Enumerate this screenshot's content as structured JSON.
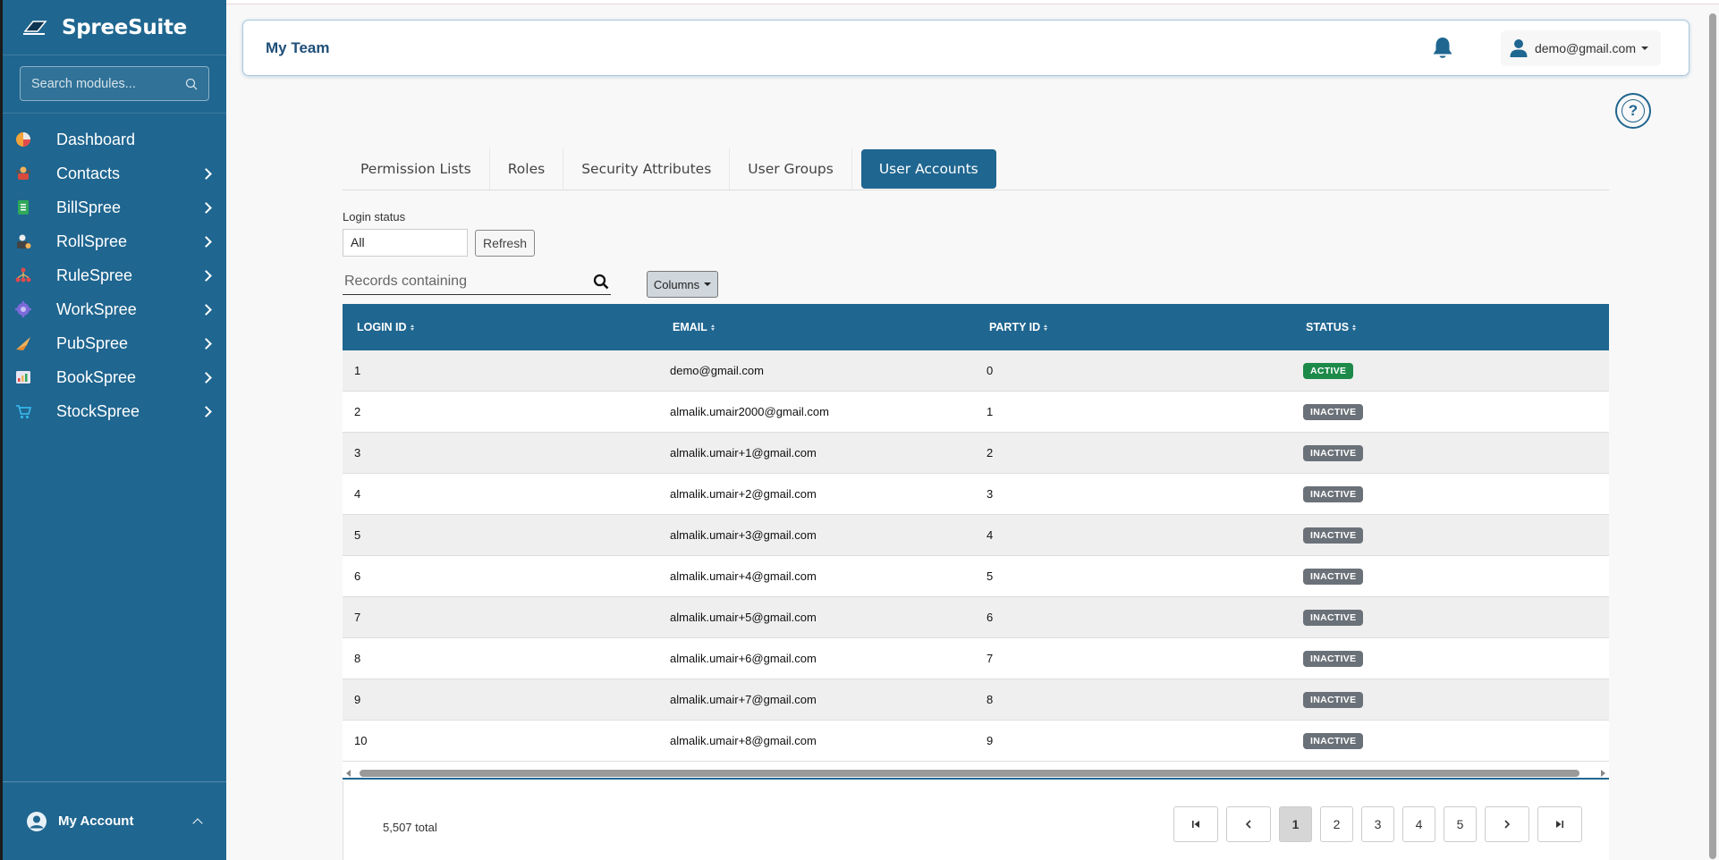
{
  "brand": {
    "name": "SpreeSuite"
  },
  "sidebar": {
    "search_placeholder": "Search modules...",
    "items": [
      {
        "label": "Dashboard",
        "icon": "dashboard-pie-icon",
        "has_children": false
      },
      {
        "label": "Contacts",
        "icon": "contacts-icon",
        "has_children": true
      },
      {
        "label": "BillSpree",
        "icon": "billspree-icon",
        "has_children": true
      },
      {
        "label": "RollSpree",
        "icon": "rollspree-icon",
        "has_children": true
      },
      {
        "label": "RuleSpree",
        "icon": "rulespree-icon",
        "has_children": true
      },
      {
        "label": "WorkSpree",
        "icon": "workspree-icon",
        "has_children": true
      },
      {
        "label": "PubSpree",
        "icon": "pubspree-icon",
        "has_children": true
      },
      {
        "label": "BookSpree",
        "icon": "bookspree-icon",
        "has_children": true
      },
      {
        "label": "StockSpree",
        "icon": "stockspree-icon",
        "has_children": true
      }
    ],
    "account_label": "My Account"
  },
  "header": {
    "title": "My Team",
    "user_email": "demo@gmail.com"
  },
  "help_label": "?",
  "tabs": [
    {
      "label": "Permission Lists",
      "active": false
    },
    {
      "label": "Roles",
      "active": false
    },
    {
      "label": "Security Attributes",
      "active": false
    },
    {
      "label": "User Groups",
      "active": false
    },
    {
      "label": "User Accounts",
      "active": true
    }
  ],
  "filters": {
    "login_status_label": "Login status",
    "login_status_value": "All",
    "refresh_label": "Refresh",
    "records_placeholder": "Records containing",
    "columns_label": "Columns"
  },
  "table": {
    "headers": [
      "LOGIN ID",
      "EMAIL",
      "PARTY ID",
      "STATUS"
    ],
    "rows": [
      {
        "login_id": "1",
        "email": "demo@gmail.com",
        "party_id": "0",
        "status": "ACTIVE"
      },
      {
        "login_id": "2",
        "email": "almalik.umair2000@gmail.com",
        "party_id": "1",
        "status": "INACTIVE"
      },
      {
        "login_id": "3",
        "email": "almalik.umair+1@gmail.com",
        "party_id": "2",
        "status": "INACTIVE"
      },
      {
        "login_id": "4",
        "email": "almalik.umair+2@gmail.com",
        "party_id": "3",
        "status": "INACTIVE"
      },
      {
        "login_id": "5",
        "email": "almalik.umair+3@gmail.com",
        "party_id": "4",
        "status": "INACTIVE"
      },
      {
        "login_id": "6",
        "email": "almalik.umair+4@gmail.com",
        "party_id": "5",
        "status": "INACTIVE"
      },
      {
        "login_id": "7",
        "email": "almalik.umair+5@gmail.com",
        "party_id": "6",
        "status": "INACTIVE"
      },
      {
        "login_id": "8",
        "email": "almalik.umair+6@gmail.com",
        "party_id": "7",
        "status": "INACTIVE"
      },
      {
        "login_id": "9",
        "email": "almalik.umair+7@gmail.com",
        "party_id": "8",
        "status": "INACTIVE"
      },
      {
        "login_id": "10",
        "email": "almalik.umair+8@gmail.com",
        "party_id": "9",
        "status": "INACTIVE"
      }
    ],
    "total_label": "5,507 total"
  },
  "pagination": {
    "pages": [
      "1",
      "2",
      "3",
      "4",
      "5"
    ],
    "current": "1"
  },
  "colors": {
    "primary": "#1f6690",
    "active_badge": "#1d8a4a",
    "inactive_badge": "#6b7178"
  }
}
